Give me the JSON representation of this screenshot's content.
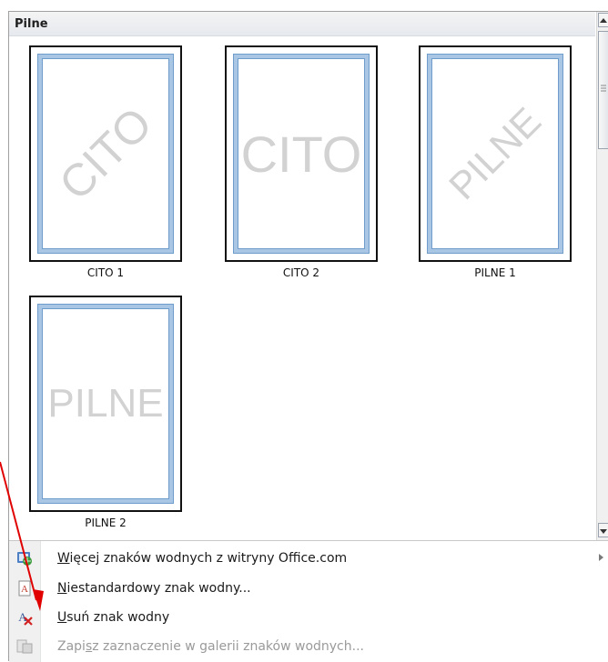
{
  "gallery": {
    "section_title": "Pilne",
    "items": [
      {
        "caption": "CITO 1",
        "watermark": "CITO"
      },
      {
        "caption": "CITO 2",
        "watermark": "CITO"
      },
      {
        "caption": "PILNE 1",
        "watermark": "PILNE"
      },
      {
        "caption": "PILNE 2",
        "watermark": "PILNE"
      }
    ]
  },
  "menu": {
    "more": {
      "prefix": "",
      "key": "W",
      "rest": "ięcej znaków wodnych z witryny Office.com",
      "icon": "office-globe-icon"
    },
    "custom": {
      "prefix": "",
      "key": "N",
      "rest": "iestandardowy znak wodny...",
      "icon": "custom-watermark-icon"
    },
    "remove": {
      "prefix": "",
      "key": "U",
      "rest": "suń znak wodny",
      "icon": "remove-watermark-icon"
    },
    "save": {
      "prefix": "Zapi",
      "key": "s",
      "rest": "z zaznaczenie w galerii znaków wodnych...",
      "icon": "save-to-gallery-icon"
    }
  },
  "colors": {
    "annotation_arrow": "#e00000",
    "frame": "#a9c7e5"
  }
}
